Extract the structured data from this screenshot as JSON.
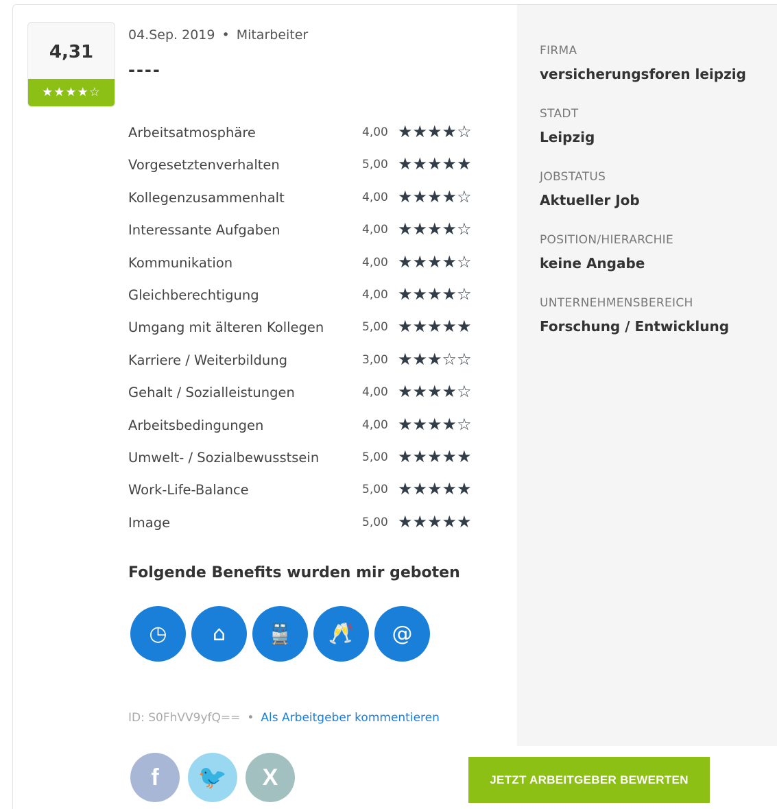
{
  "review": {
    "score": "4,31",
    "score_stars": "★★★★☆",
    "date": "04.Sep. 2019",
    "separator": "•",
    "role": "Mitarbeiter",
    "title": "----"
  },
  "ratings": [
    {
      "label": "Arbeitsatmosphäre",
      "value": "4,00",
      "stars": "★★★★☆"
    },
    {
      "label": "Vorgesetztenverhalten",
      "value": "5,00",
      "stars": "★★★★★"
    },
    {
      "label": "Kollegenzusammenhalt",
      "value": "4,00",
      "stars": "★★★★☆"
    },
    {
      "label": "Interessante Aufgaben",
      "value": "4,00",
      "stars": "★★★★☆"
    },
    {
      "label": "Kommunikation",
      "value": "4,00",
      "stars": "★★★★☆"
    },
    {
      "label": "Gleichberechtigung",
      "value": "4,00",
      "stars": "★★★★☆"
    },
    {
      "label": "Umgang mit älteren Kollegen",
      "value": "5,00",
      "stars": "★★★★★"
    },
    {
      "label": "Karriere / Weiterbildung",
      "value": "3,00",
      "stars": "★★★☆☆"
    },
    {
      "label": "Gehalt / Sozialleistungen",
      "value": "4,00",
      "stars": "★★★★☆"
    },
    {
      "label": "Arbeitsbedingungen",
      "value": "4,00",
      "stars": "★★★★☆"
    },
    {
      "label": "Umwelt- / Sozialbewusstsein",
      "value": "5,00",
      "stars": "★★★★★"
    },
    {
      "label": "Work-Life-Balance",
      "value": "5,00",
      "stars": "★★★★★"
    },
    {
      "label": "Image",
      "value": "5,00",
      "stars": "★★★★★"
    }
  ],
  "benefits": {
    "title": "Folgende Benefits wurden mir geboten",
    "icons": [
      {
        "name": "flexible-hours-icon",
        "glyph": "◷"
      },
      {
        "name": "home-office-icon",
        "glyph": "⌂"
      },
      {
        "name": "public-transport-icon",
        "glyph": "🚆"
      },
      {
        "name": "company-events-icon",
        "glyph": "🥂"
      },
      {
        "name": "internet-usage-icon",
        "glyph": "@"
      }
    ]
  },
  "footer": {
    "id": "ID: S0FhVV9yfQ==",
    "separator": "•",
    "comment_link": "Als Arbeitgeber kommentieren",
    "cta": "JETZT ARBEITGEBER BEWERTEN",
    "social": [
      {
        "name": "facebook-icon",
        "glyph": "f"
      },
      {
        "name": "twitter-icon",
        "glyph": "🐦"
      },
      {
        "name": "xing-icon",
        "glyph": "X"
      }
    ]
  },
  "sidebar": {
    "firma_label": "FIRMA",
    "firma_value": "versicherungsforen leipzig",
    "stadt_label": "STADT",
    "stadt_value": "Leipzig",
    "jobstatus_label": "JOBSTATUS",
    "jobstatus_value": "Aktueller Job",
    "position_label": "POSITION/HIERARCHIE",
    "position_value": "keine Angabe",
    "bereich_label": "UNTERNEHMENSBEREICH",
    "bereich_value": "Forschung / Entwicklung"
  },
  "colors": {
    "accent_green": "#8cc014",
    "benefit_blue": "#1a7fd9",
    "star_dark": "#333d47"
  }
}
